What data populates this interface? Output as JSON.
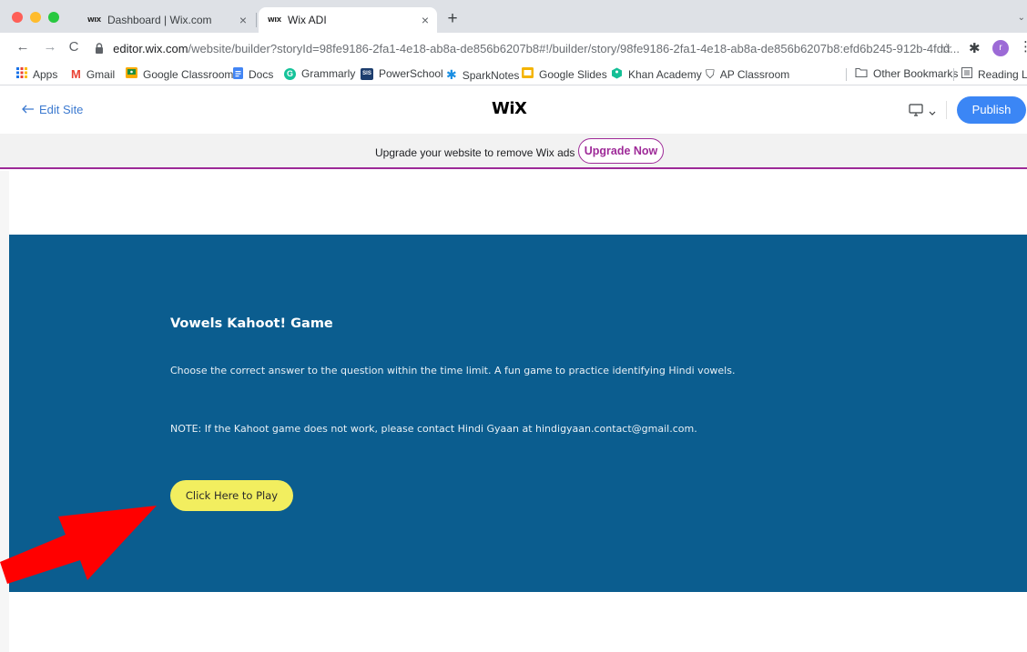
{
  "browser": {
    "tabs": [
      {
        "favicon": "WIX",
        "title": "Dashboard | Wix.com",
        "active": false
      },
      {
        "favicon": "WIX",
        "title": "Wix ADI",
        "active": true
      }
    ],
    "tab_close_glyph": "×",
    "new_tab_glyph": "+",
    "tab_menu_glyph": "⌄",
    "back_glyph": "←",
    "forward_glyph": "→",
    "reload_glyph": "C",
    "url_host": "editor.wix.com",
    "url_path": "/website/builder?storyId=98fe9186-2fa1-4e18-ab8a-de856b6207b8#!/builder/story/98fe9186-2fa1-4e18-ab8a-de856b6207b8:efd6b245-912b-4fdd...",
    "star_glyph": "☆",
    "extensions_glyph": "✱",
    "profile_initial": "r",
    "menu_glyph": "⋮"
  },
  "bookmarks": [
    {
      "label": "Apps",
      "icon": "apps-grid-icon"
    },
    {
      "label": "Gmail",
      "icon": "gmail-icon"
    },
    {
      "label": "Google Classroom",
      "icon": "classroom-icon"
    },
    {
      "label": "Docs",
      "icon": "docs-icon"
    },
    {
      "label": "Grammarly",
      "icon": "grammarly-icon"
    },
    {
      "label": "PowerSchool",
      "icon": "powerschool-icon"
    },
    {
      "label": "SparkNotes",
      "icon": "sparknotes-icon"
    },
    {
      "label": "Google Slides",
      "icon": "slides-icon"
    },
    {
      "label": "Khan Academy",
      "icon": "khan-academy-icon"
    },
    {
      "label": "AP Classroom",
      "icon": "ap-classroom-icon"
    }
  ],
  "bookmarks_right": [
    {
      "label": "Other Bookmarks",
      "icon": "folder-icon"
    },
    {
      "label": "Reading Lis",
      "icon": "reading-list-icon"
    }
  ],
  "wix_header": {
    "back_label": "Edit Site",
    "logo": "WiX",
    "publish_label": "Publish"
  },
  "upgrade_banner": {
    "text": "Upgrade your website to remove Wix ads",
    "button_label": "Upgrade Now"
  },
  "content": {
    "title": "Vowels Kahoot! Game",
    "description": "Choose the correct answer to the question within the time limit. A fun game to practice identifying Hindi vowels.",
    "note": "NOTE: If the Kahoot game does not work, please contact Hindi Gyaan at hindigyaan.contact@gmail.com.",
    "button_label": "Click Here to Play"
  },
  "colors": {
    "accent_blue": "#3b86f5",
    "wix_purple": "#9e2a98",
    "section_blue": "#0b5d8f",
    "play_button_yellow": "#f2ee5f",
    "annotation_red": "#ff0000"
  }
}
